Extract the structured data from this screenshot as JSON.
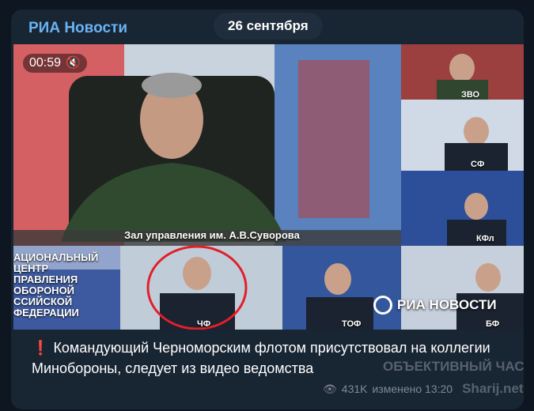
{
  "header": {
    "channel_name": "РИА Новости",
    "date": "26 сентября"
  },
  "video": {
    "timer": "00:59",
    "mute_icon": "muted-speaker-icon",
    "hall_caption": "Зал управления им. А.В.Суворова",
    "screen_text_lines": [
      "АЦИОНАЛЬНЫЙ ЦЕНТР",
      "ПРАВЛЕНИЯ ОБОРОНОЙ",
      "ССИЙСКОЙ ФЕДЕРАЦИИ"
    ],
    "fleet_labels": [
      "ЗВО",
      "СФ",
      "КФл",
      "ЧФ",
      "ТОФ",
      "БФ"
    ],
    "logo_text": "РИА НОВОСТИ",
    "highlight_color": "#e0202a"
  },
  "message": {
    "alert_icon": "❗",
    "text": "Командующий Черноморским флотом присутствовал на коллегии Минобороны, следует из видео ведомства"
  },
  "meta": {
    "views": "431K",
    "edited": "изменено 13:20"
  },
  "watermark": {
    "line1": "ОБЪЕКТИВНЫЙ ЧАСТНЫЙ",
    "line2": "Sharij.net"
  }
}
